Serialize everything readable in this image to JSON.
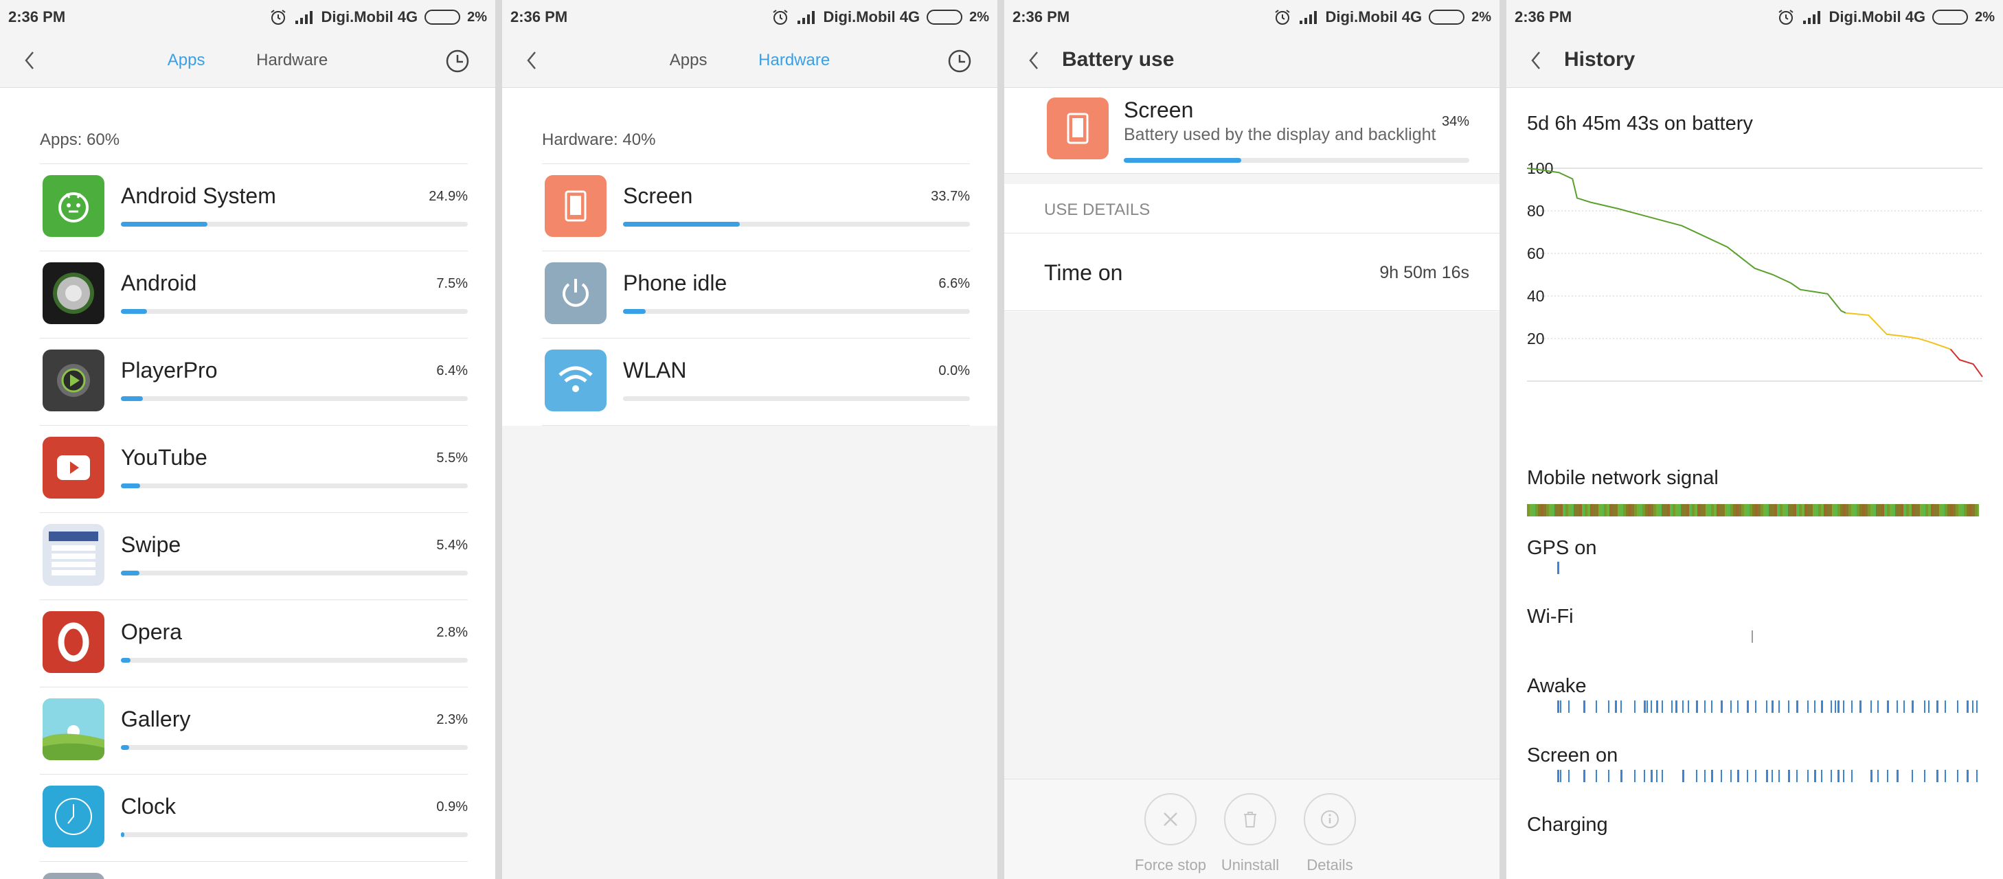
{
  "status": {
    "time": "2:36 PM",
    "carrier": "Digi.Mobil 4G",
    "battery_pct": "2%"
  },
  "colors": {
    "accent": "#3aa0e6",
    "chart_green": "#5aa02c",
    "chart_yellow": "#f2c21b",
    "chart_red": "#d32f2f"
  },
  "screen1": {
    "tabs": [
      "Apps",
      "Hardware"
    ],
    "section_title": "Apps: 60%",
    "items": [
      {
        "name": "Android System",
        "value": "24.9%",
        "fraction": 0.249,
        "icon": "android-robot-icon",
        "color": "#4caf3d"
      },
      {
        "name": "Android",
        "value": "7.5%",
        "fraction": 0.075,
        "icon": "android-dial-icon",
        "color": "#1a1a1a"
      },
      {
        "name": "PlayerPro",
        "value": "6.4%",
        "fraction": 0.064,
        "icon": "playerpro-icon",
        "color": "#3d3d3d"
      },
      {
        "name": "YouTube",
        "value": "5.5%",
        "fraction": 0.055,
        "icon": "youtube-icon",
        "color": "#d0412f"
      },
      {
        "name": "Swipe",
        "value": "5.4%",
        "fraction": 0.054,
        "icon": "swipe-icon",
        "color": "#dfe6f0"
      },
      {
        "name": "Opera",
        "value": "2.8%",
        "fraction": 0.028,
        "icon": "opera-icon",
        "color": "#cc3b2c"
      },
      {
        "name": "Gallery",
        "value": "2.3%",
        "fraction": 0.023,
        "icon": "gallery-icon",
        "color": "#7fd3c3"
      },
      {
        "name": "Clock",
        "value": "0.9%",
        "fraction": 0.009,
        "icon": "clock-icon",
        "color": "#2ba8d8"
      }
    ]
  },
  "screen2": {
    "tabs": [
      "Apps",
      "Hardware"
    ],
    "section_title": "Hardware: 40%",
    "items": [
      {
        "name": "Screen",
        "value": "33.7%",
        "fraction": 0.337,
        "icon": "screen-icon",
        "color": "#f2876a"
      },
      {
        "name": "Phone idle",
        "value": "6.6%",
        "fraction": 0.066,
        "icon": "power-icon",
        "color": "#8fa9bd"
      },
      {
        "name": "WLAN",
        "value": "0.0%",
        "fraction": 0.0,
        "icon": "wifi-icon",
        "color": "#5cb3e3"
      }
    ]
  },
  "screen3": {
    "title": "Battery use",
    "item_name": "Screen",
    "item_desc": "Battery used by the display and backlight",
    "item_pct": "34%",
    "item_fraction": 0.34,
    "use_details_label": "USE DETAILS",
    "time_on_label": "Time on",
    "time_on_value": "9h 50m 16s",
    "buttons": [
      "Force stop",
      "Uninstall",
      "Details"
    ]
  },
  "screen4": {
    "title": "History",
    "subtitle": "5d 6h 45m 43s on battery",
    "rows": [
      "Mobile network signal",
      "GPS on",
      "Wi-Fi",
      "Awake",
      "Screen on",
      "Charging"
    ]
  },
  "chart_data": {
    "type": "line",
    "xlabel": "",
    "ylabel": "",
    "ylim": [
      0,
      100
    ],
    "yticks": [
      100,
      80,
      60,
      40,
      20
    ],
    "grid": true,
    "x": [
      0,
      0.02,
      0.07,
      0.1,
      0.11,
      0.14,
      0.2,
      0.27,
      0.34,
      0.39,
      0.44,
      0.5,
      0.54,
      0.58,
      0.6,
      0.63,
      0.66,
      0.69,
      0.7,
      0.75,
      0.79,
      0.83,
      0.86,
      0.89,
      0.93,
      0.95,
      0.98,
      1.0
    ],
    "y": [
      100,
      99.5,
      98,
      95,
      86,
      84,
      81,
      77,
      73,
      68,
      63,
      53,
      50,
      46,
      43,
      42,
      41,
      33,
      32,
      31,
      22,
      21,
      20,
      18,
      15,
      10,
      8,
      2
    ],
    "series": [
      {
        "name": "",
        "color": "green",
        "from_index": 0,
        "to_index": 18
      },
      {
        "name": "",
        "color": "yellow",
        "from_index": 18,
        "to_index": 24
      },
      {
        "name": "",
        "color": "red",
        "from_index": 24,
        "to_index": 27
      }
    ]
  }
}
